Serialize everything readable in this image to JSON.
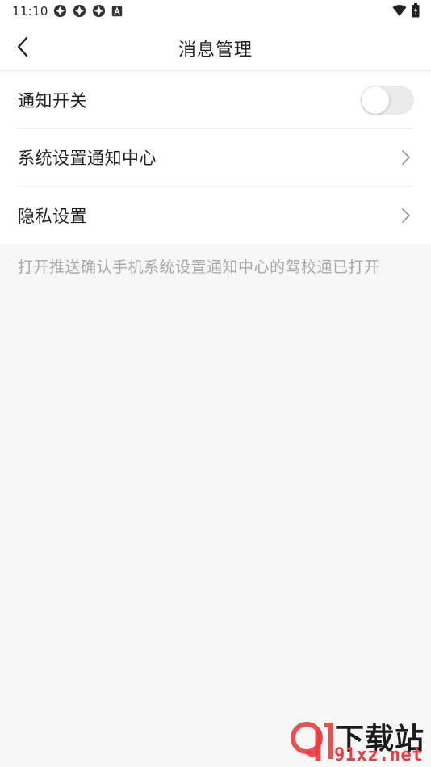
{
  "status_bar": {
    "time": "11:10",
    "left_icons": [
      "app-notification-icon",
      "app-notification-icon",
      "app-notification-icon",
      "keyboard-a-icon"
    ],
    "right_icons": [
      "wifi-icon",
      "battery-icon"
    ]
  },
  "header": {
    "title": "消息管理",
    "back_icon": "chevron-left-icon"
  },
  "settings": {
    "items": [
      {
        "label": "通知开关",
        "control": "toggle",
        "value": false
      },
      {
        "label": "系统设置通知中心",
        "control": "chevron"
      },
      {
        "label": "隐私设置",
        "control": "chevron"
      }
    ]
  },
  "hint": "打开推送确认手机系统设置通知中心的驾校通已打开",
  "watermark": {
    "top": "下载站",
    "bottom": "91xz.net"
  },
  "colors": {
    "background": "#f7f7f7",
    "surface": "#ffffff",
    "text_primary": "#222222",
    "text_hint": "#a9a9a9",
    "toggle_off": "#ebebeb",
    "watermark_red": "#e63e3e"
  }
}
